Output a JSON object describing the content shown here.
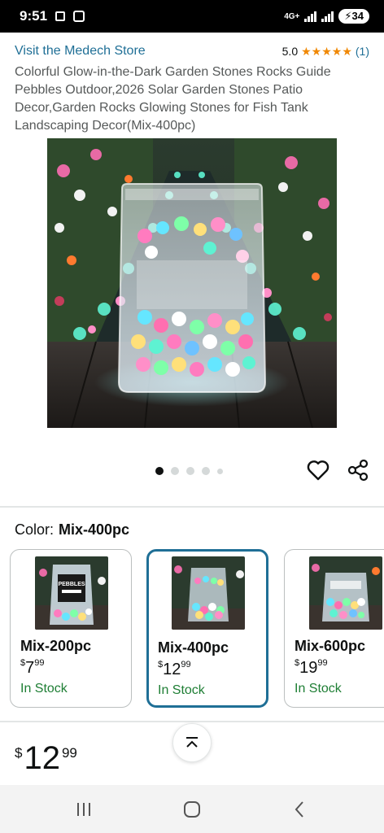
{
  "status_bar": {
    "time": "9:51",
    "network": "4G+",
    "battery": "34"
  },
  "product": {
    "store_link": "Visit the Medech Store",
    "rating": "5.0",
    "stars": "★★★★★",
    "rating_count": "(1)",
    "title": "Colorful Glow-in-the-Dark Garden Stones Rocks Guide Pebbles Outdoor,2026 Solar Garden Stones Patio Decor,Garden Rocks Glowing Stones for Fish Tank Landscaping Decor(Mix-400pc)",
    "image_pages": 5,
    "current_image": 1
  },
  "color": {
    "label": "Color:",
    "selected": "Mix-400pc",
    "options": [
      {
        "name": "Mix-200pc",
        "currency": "$",
        "dollars": "7",
        "cents": "99",
        "stock": "In Stock",
        "thumb_text": "PEBBLES"
      },
      {
        "name": "Mix-400pc",
        "currency": "$",
        "dollars": "12",
        "cents": "99",
        "stock": "In Stock"
      },
      {
        "name": "Mix-600pc",
        "currency": "$",
        "dollars": "19",
        "cents": "99",
        "stock": "In Stock"
      }
    ]
  },
  "price": {
    "currency": "$",
    "dollars": "12",
    "cents": "99"
  },
  "icons": {
    "favorite": "heart-icon",
    "share": "share-icon",
    "scroll_top": "chevron-up-icon",
    "nav_recent": "recent-apps-icon",
    "nav_home": "home-icon",
    "nav_back": "back-icon"
  },
  "colors": {
    "link": "#1f6f96",
    "star": "#f08804",
    "in_stock": "#1e7e34",
    "selected_border": "#1f6f96"
  }
}
